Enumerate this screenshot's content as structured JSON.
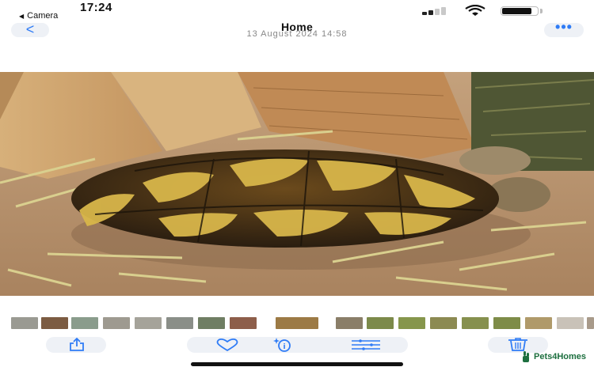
{
  "status_bar": {
    "time": "17:24",
    "back_app": "Camera",
    "back_arrow": "◀"
  },
  "nav": {
    "back_label": "<",
    "title": "Home",
    "subtitle": "13 August 2024  14:58",
    "more_label": "•••"
  },
  "photo": {
    "description_icon": "photo-tortoise"
  },
  "thumbnails": {
    "count": 18
  },
  "toolbar": {
    "share_icon": "share-icon",
    "favorite_icon": "heart-icon",
    "info_icon": "info-sparkle-icon",
    "adjust_icon": "sliders-icon",
    "delete_icon": "trash-icon"
  },
  "watermark": {
    "text": "Pets4Homes"
  },
  "colors": {
    "accent": "#2f7cf6",
    "pill": "#eef1f6",
    "watermark": "#1d6f3f"
  }
}
